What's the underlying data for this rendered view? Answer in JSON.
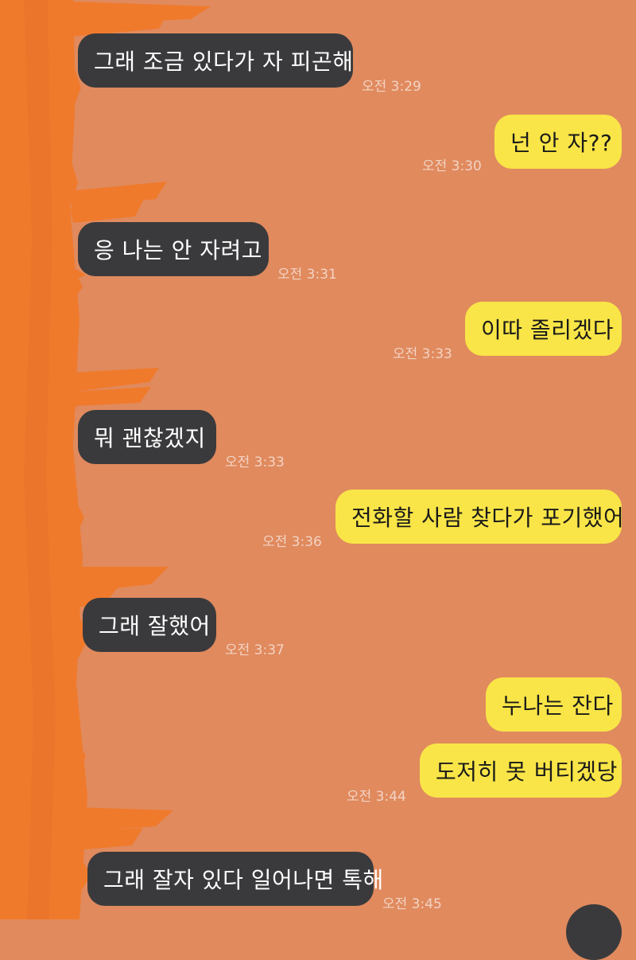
{
  "chat": {
    "messages": [
      {
        "id": "m1",
        "side": "incoming",
        "text": "그래 조금 있다가 자 피곤해",
        "time": "오전 3:29"
      },
      {
        "id": "m2",
        "side": "outgoing",
        "text": "넌 안 자??",
        "time": "오전 3:30"
      },
      {
        "id": "m3",
        "side": "incoming",
        "text": "응 나는 안 자려고",
        "time": "오전 3:31"
      },
      {
        "id": "m4",
        "side": "outgoing",
        "text": "이따 졸리겠다",
        "time": "오전 3:33"
      },
      {
        "id": "m5",
        "side": "incoming",
        "text": "뭐 괜찮겠지",
        "time": "오전 3:33"
      },
      {
        "id": "m6",
        "side": "outgoing",
        "text": "전화할 사람 찾다가 포기했어",
        "time": "오전 3:36"
      },
      {
        "id": "m7",
        "side": "incoming",
        "text": "그래 잘했어",
        "time": "오전 3:37"
      },
      {
        "id": "m8",
        "side": "outgoing",
        "text": "누나는 잔다",
        "time": ""
      },
      {
        "id": "m9",
        "side": "outgoing",
        "text": "도저히 못 버티겠당",
        "time": "오전 3:44"
      },
      {
        "id": "m10",
        "side": "incoming",
        "text": "그래 잘자 있다 일어나면 톡해",
        "time": "오전 3:45"
      }
    ]
  },
  "colors": {
    "background": "#E08A5E",
    "incoming_bubble": "#3A3A3C",
    "outgoing_bubble": "#F9E547",
    "redaction_scribble": "#F07A2C"
  }
}
